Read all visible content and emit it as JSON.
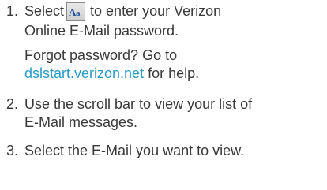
{
  "steps": [
    {
      "number": "1.",
      "line1_before": "Select",
      "icon": "text-input-icon",
      "line1_after": "to enter your Verizon",
      "line2": "Online E-Mail password."
    },
    {
      "number": "2.",
      "line1": "Use the scroll bar to view your list of",
      "line2": "E-Mail messages."
    },
    {
      "number": "3.",
      "line1": "Select the E-Mail you want to view."
    }
  ],
  "note": {
    "line1": "Forgot password? Go to",
    "link": "dslstart.verizon.net",
    "after_link": "for help."
  },
  "colors": {
    "text": "#3a3a3a",
    "link": "#2a9bc9"
  }
}
